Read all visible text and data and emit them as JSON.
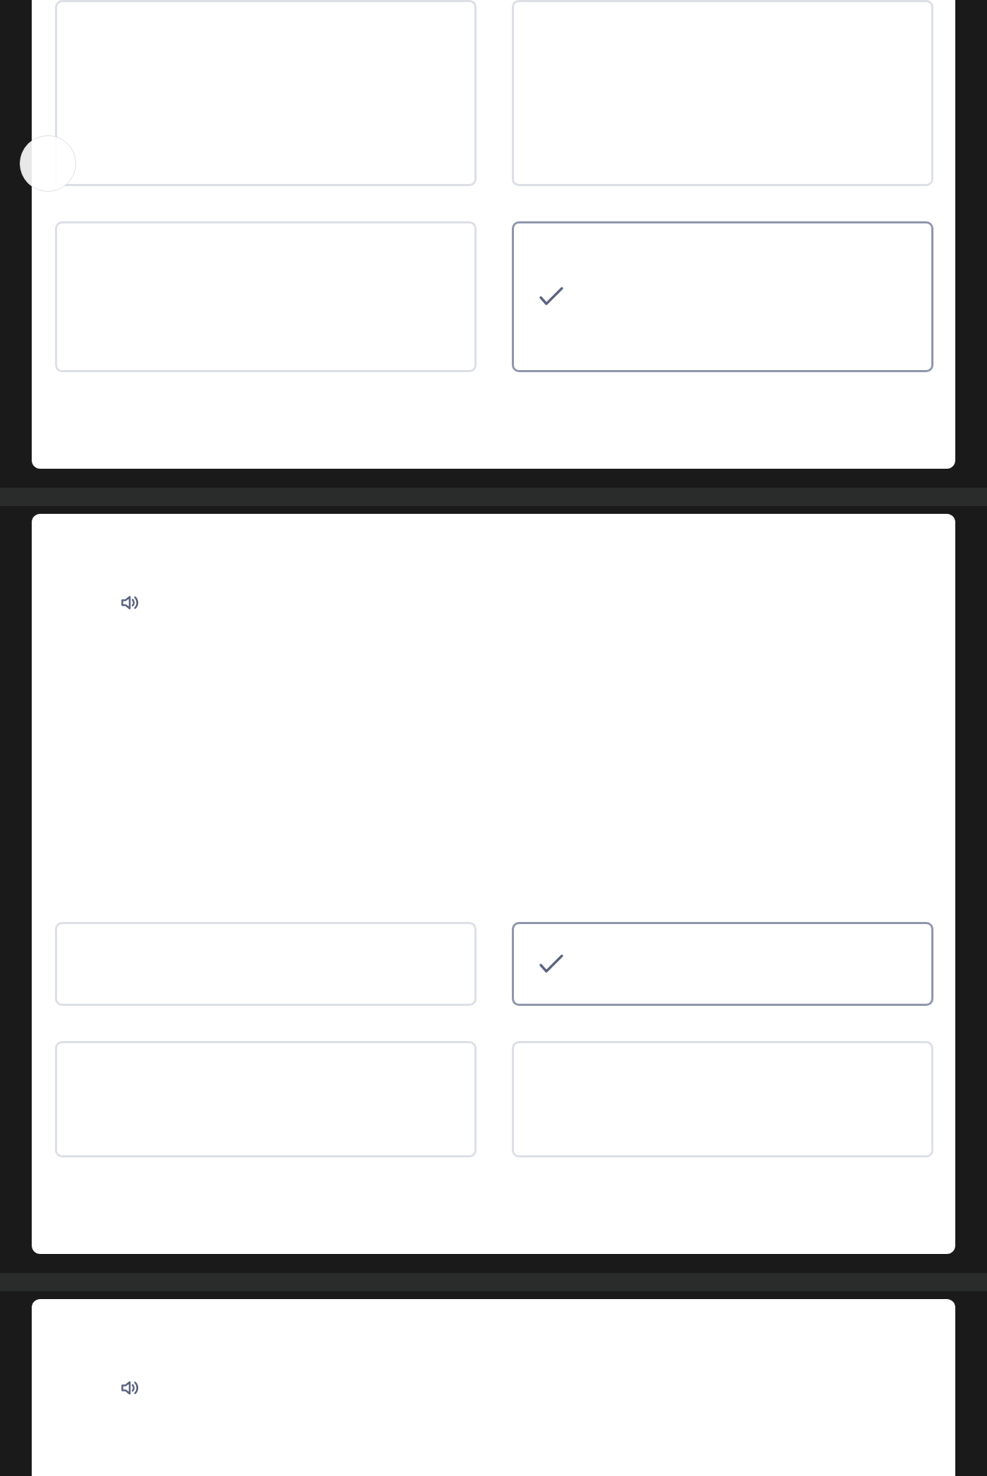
{
  "touch_indicator": true,
  "cards": [
    {
      "options": [
        {
          "selected": false
        },
        {
          "selected": false
        },
        {
          "selected": false
        },
        {
          "selected": true
        }
      ]
    },
    {
      "audio": true,
      "options": [
        {
          "selected": false
        },
        {
          "selected": true
        },
        {
          "selected": false
        },
        {
          "selected": false
        }
      ]
    },
    {
      "audio": true
    }
  ]
}
